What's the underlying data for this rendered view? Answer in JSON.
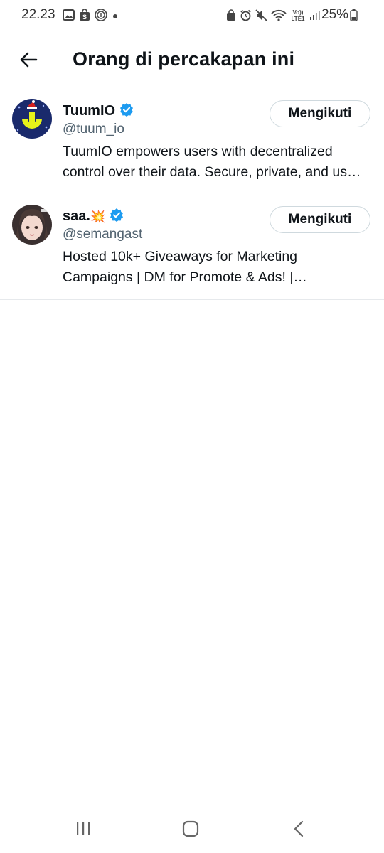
{
  "status_bar": {
    "time": "22.23",
    "battery_percent": "25%",
    "left_icons": [
      "gallery-icon",
      "shop-icon",
      "fingerprint-icon",
      "dot-icon"
    ],
    "right_icons": [
      "lock-home-icon",
      "alarm-icon",
      "mute-icon",
      "wifi-icon",
      "volte-icon",
      "signal-icon"
    ]
  },
  "header": {
    "title": "Orang di percakapan ini"
  },
  "users": [
    {
      "name": "TuumIO",
      "emoji": "",
      "verified": true,
      "handle": "@tuum_io",
      "bio": "TuumIO empowers users with decentralized control over their data. Secure, private, and user-centric solutions for the future.",
      "follow_label": "Mengikuti"
    },
    {
      "name": "saa.",
      "emoji": "💥",
      "verified": true,
      "handle": "@semangast",
      "bio": "Hosted 10k+ Giveaways for Marketing Campaigns | DM for Promote & Ads! | #saagiveaway",
      "follow_label": "Mengikuti"
    }
  ],
  "colors": {
    "verified": "#1d9bf0",
    "text_primary": "#0f1419",
    "text_secondary": "#536471",
    "border": "#cfd9de"
  }
}
